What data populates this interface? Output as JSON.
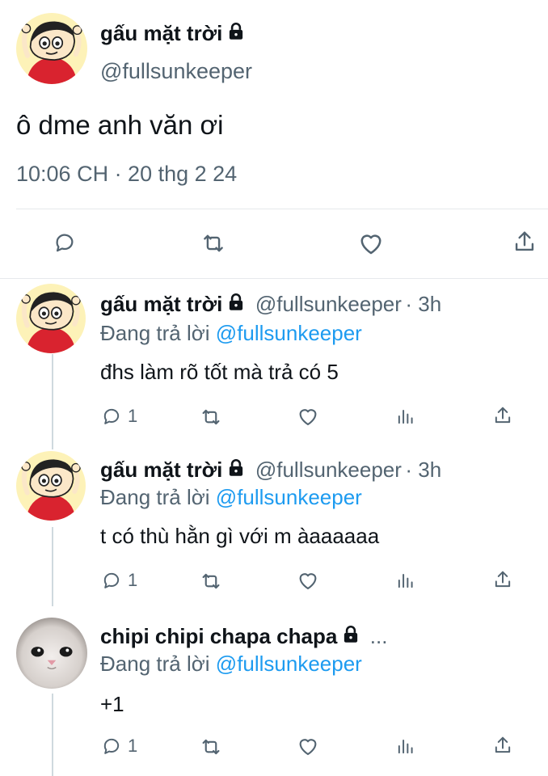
{
  "main_tweet": {
    "author_name": "gấu mặt trời",
    "author_handle": "@fullsunkeeper",
    "text": "ô dme anh văn ơi",
    "timestamp": "10:06 CH · 20 thg 2 24"
  },
  "replies": [
    {
      "author_name": "gấu mặt trời",
      "author_handle": "@fullsunkeeper",
      "time": "· 3h",
      "replying_prefix": "Đang trả lời",
      "replying_to": "@fullsunkeeper",
      "text": "đhs làm rõ tốt mà trả có 5",
      "reply_count": "1"
    },
    {
      "author_name": "gấu mặt trời",
      "author_handle": "@fullsunkeeper",
      "time": "· 3h",
      "replying_prefix": "Đang trả lời",
      "replying_to": "@fullsunkeeper",
      "text": "t có thù hằn gì với m àaaaaaa",
      "reply_count": "1"
    },
    {
      "author_name": "chipi chipi chapa chapa",
      "more": "...",
      "replying_prefix": "Đang trả lời",
      "replying_to": "@fullsunkeeper",
      "text": "+1",
      "reply_count": "1"
    }
  ],
  "icons": {
    "reply": "reply-icon",
    "retweet": "retweet-icon",
    "like": "like-icon",
    "share": "share-icon",
    "views": "views-icon",
    "lock": "lock-icon"
  },
  "colors": {
    "link": "#1d9bf0",
    "muted": "#536471",
    "avatar_bg": "#fdf2b8",
    "shirt": "#d9232f"
  }
}
